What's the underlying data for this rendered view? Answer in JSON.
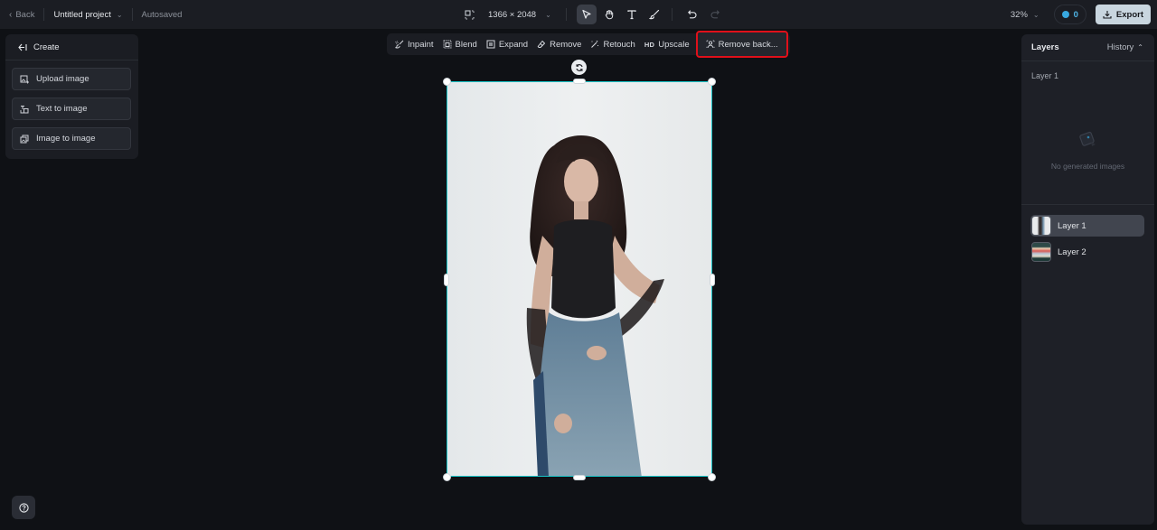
{
  "topbar": {
    "back_label": "Back",
    "project_title": "Untitled project",
    "save_status": "Autosaved",
    "canvas_size": "1366 × 2048",
    "zoom_level": "32%",
    "credits": "0",
    "export_label": "Export"
  },
  "tools": [
    {
      "name": "select",
      "icon": "cursor-arrow-icon",
      "active": true
    },
    {
      "name": "hand",
      "icon": "hand-icon",
      "active": false
    },
    {
      "name": "text",
      "icon": "text-icon",
      "active": false
    },
    {
      "name": "brush",
      "icon": "brush-icon",
      "active": false
    },
    {
      "name": "undo",
      "icon": "undo-icon",
      "active": false
    },
    {
      "name": "redo",
      "icon": "redo-icon",
      "active": false,
      "disabled": true
    }
  ],
  "create_panel": {
    "title": "Create",
    "buttons": [
      {
        "label": "Upload image",
        "icon": "upload-image-icon"
      },
      {
        "label": "Text to image",
        "icon": "text-to-image-icon"
      },
      {
        "label": "Image to image",
        "icon": "image-to-image-icon"
      }
    ]
  },
  "actions": [
    {
      "label": "Inpaint",
      "icon": "inpaint-icon"
    },
    {
      "label": "Blend",
      "icon": "blend-icon"
    },
    {
      "label": "Expand",
      "icon": "expand-icon"
    },
    {
      "label": "Remove",
      "icon": "eraser-icon"
    },
    {
      "label": "Retouch",
      "icon": "magic-wand-icon"
    },
    {
      "label": "Upscale",
      "icon": "hd-icon",
      "badge": "HD"
    },
    {
      "label": "Remove back...",
      "icon": "remove-background-icon",
      "highlighted": true
    }
  ],
  "highlight_color": "#e0101a",
  "selection_color": "#19c4c8",
  "layers_panel": {
    "title": "Layers",
    "history_label": "History",
    "current_layer": "Layer 1",
    "empty_text": "No generated images",
    "layers": [
      {
        "label": "Layer 1",
        "active": true
      },
      {
        "label": "Layer 2",
        "active": false
      }
    ]
  }
}
